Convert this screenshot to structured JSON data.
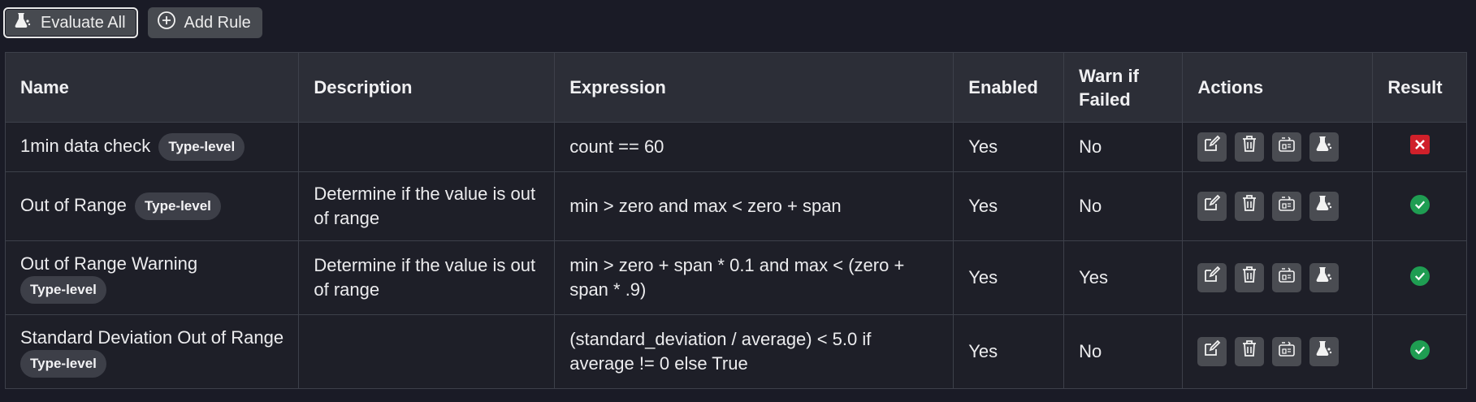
{
  "toolbar": {
    "evaluate_all_label": "Evaluate All",
    "evaluate_all_icon": "flask-icon",
    "add_rule_label": "Add Rule",
    "add_rule_icon": "plus-circle-icon"
  },
  "table": {
    "columns": [
      "Name",
      "Description",
      "Expression",
      "Enabled",
      "Warn if Failed",
      "Actions",
      "Result"
    ],
    "rows": [
      {
        "name": "1min data check",
        "badge": "Type-level",
        "description": "",
        "expression": "count == 60",
        "enabled": "Yes",
        "warn_if_failed": "No",
        "result": "fail"
      },
      {
        "name": "Out of Range",
        "badge": "Type-level",
        "description": "Determine if the value is out of range",
        "expression": "min > zero and max < zero + span",
        "enabled": "Yes",
        "warn_if_failed": "No",
        "result": "pass"
      },
      {
        "name": "Out of Range Warning",
        "badge": "Type-level",
        "description": "Determine if the value is out of range",
        "expression": "min > zero + span * 0.1 and max < (zero + span * .9)",
        "enabled": "Yes",
        "warn_if_failed": "Yes",
        "result": "pass"
      },
      {
        "name": "Standard Deviation Out of Range",
        "badge": "Type-level",
        "description": "",
        "expression": "(standard_deviation / average) < 5.0 if average != 0 else True",
        "enabled": "Yes",
        "warn_if_failed": "No",
        "result": "pass"
      }
    ],
    "row_actions": [
      "edit-icon",
      "trash-icon",
      "test-expression-icon",
      "evaluate-flask-icon"
    ]
  },
  "colors": {
    "background": "#1a1b26",
    "header_bg": "#2c2e37",
    "button_bg": "#474a50",
    "fail": "#d0202a",
    "pass": "#1f9d52"
  }
}
